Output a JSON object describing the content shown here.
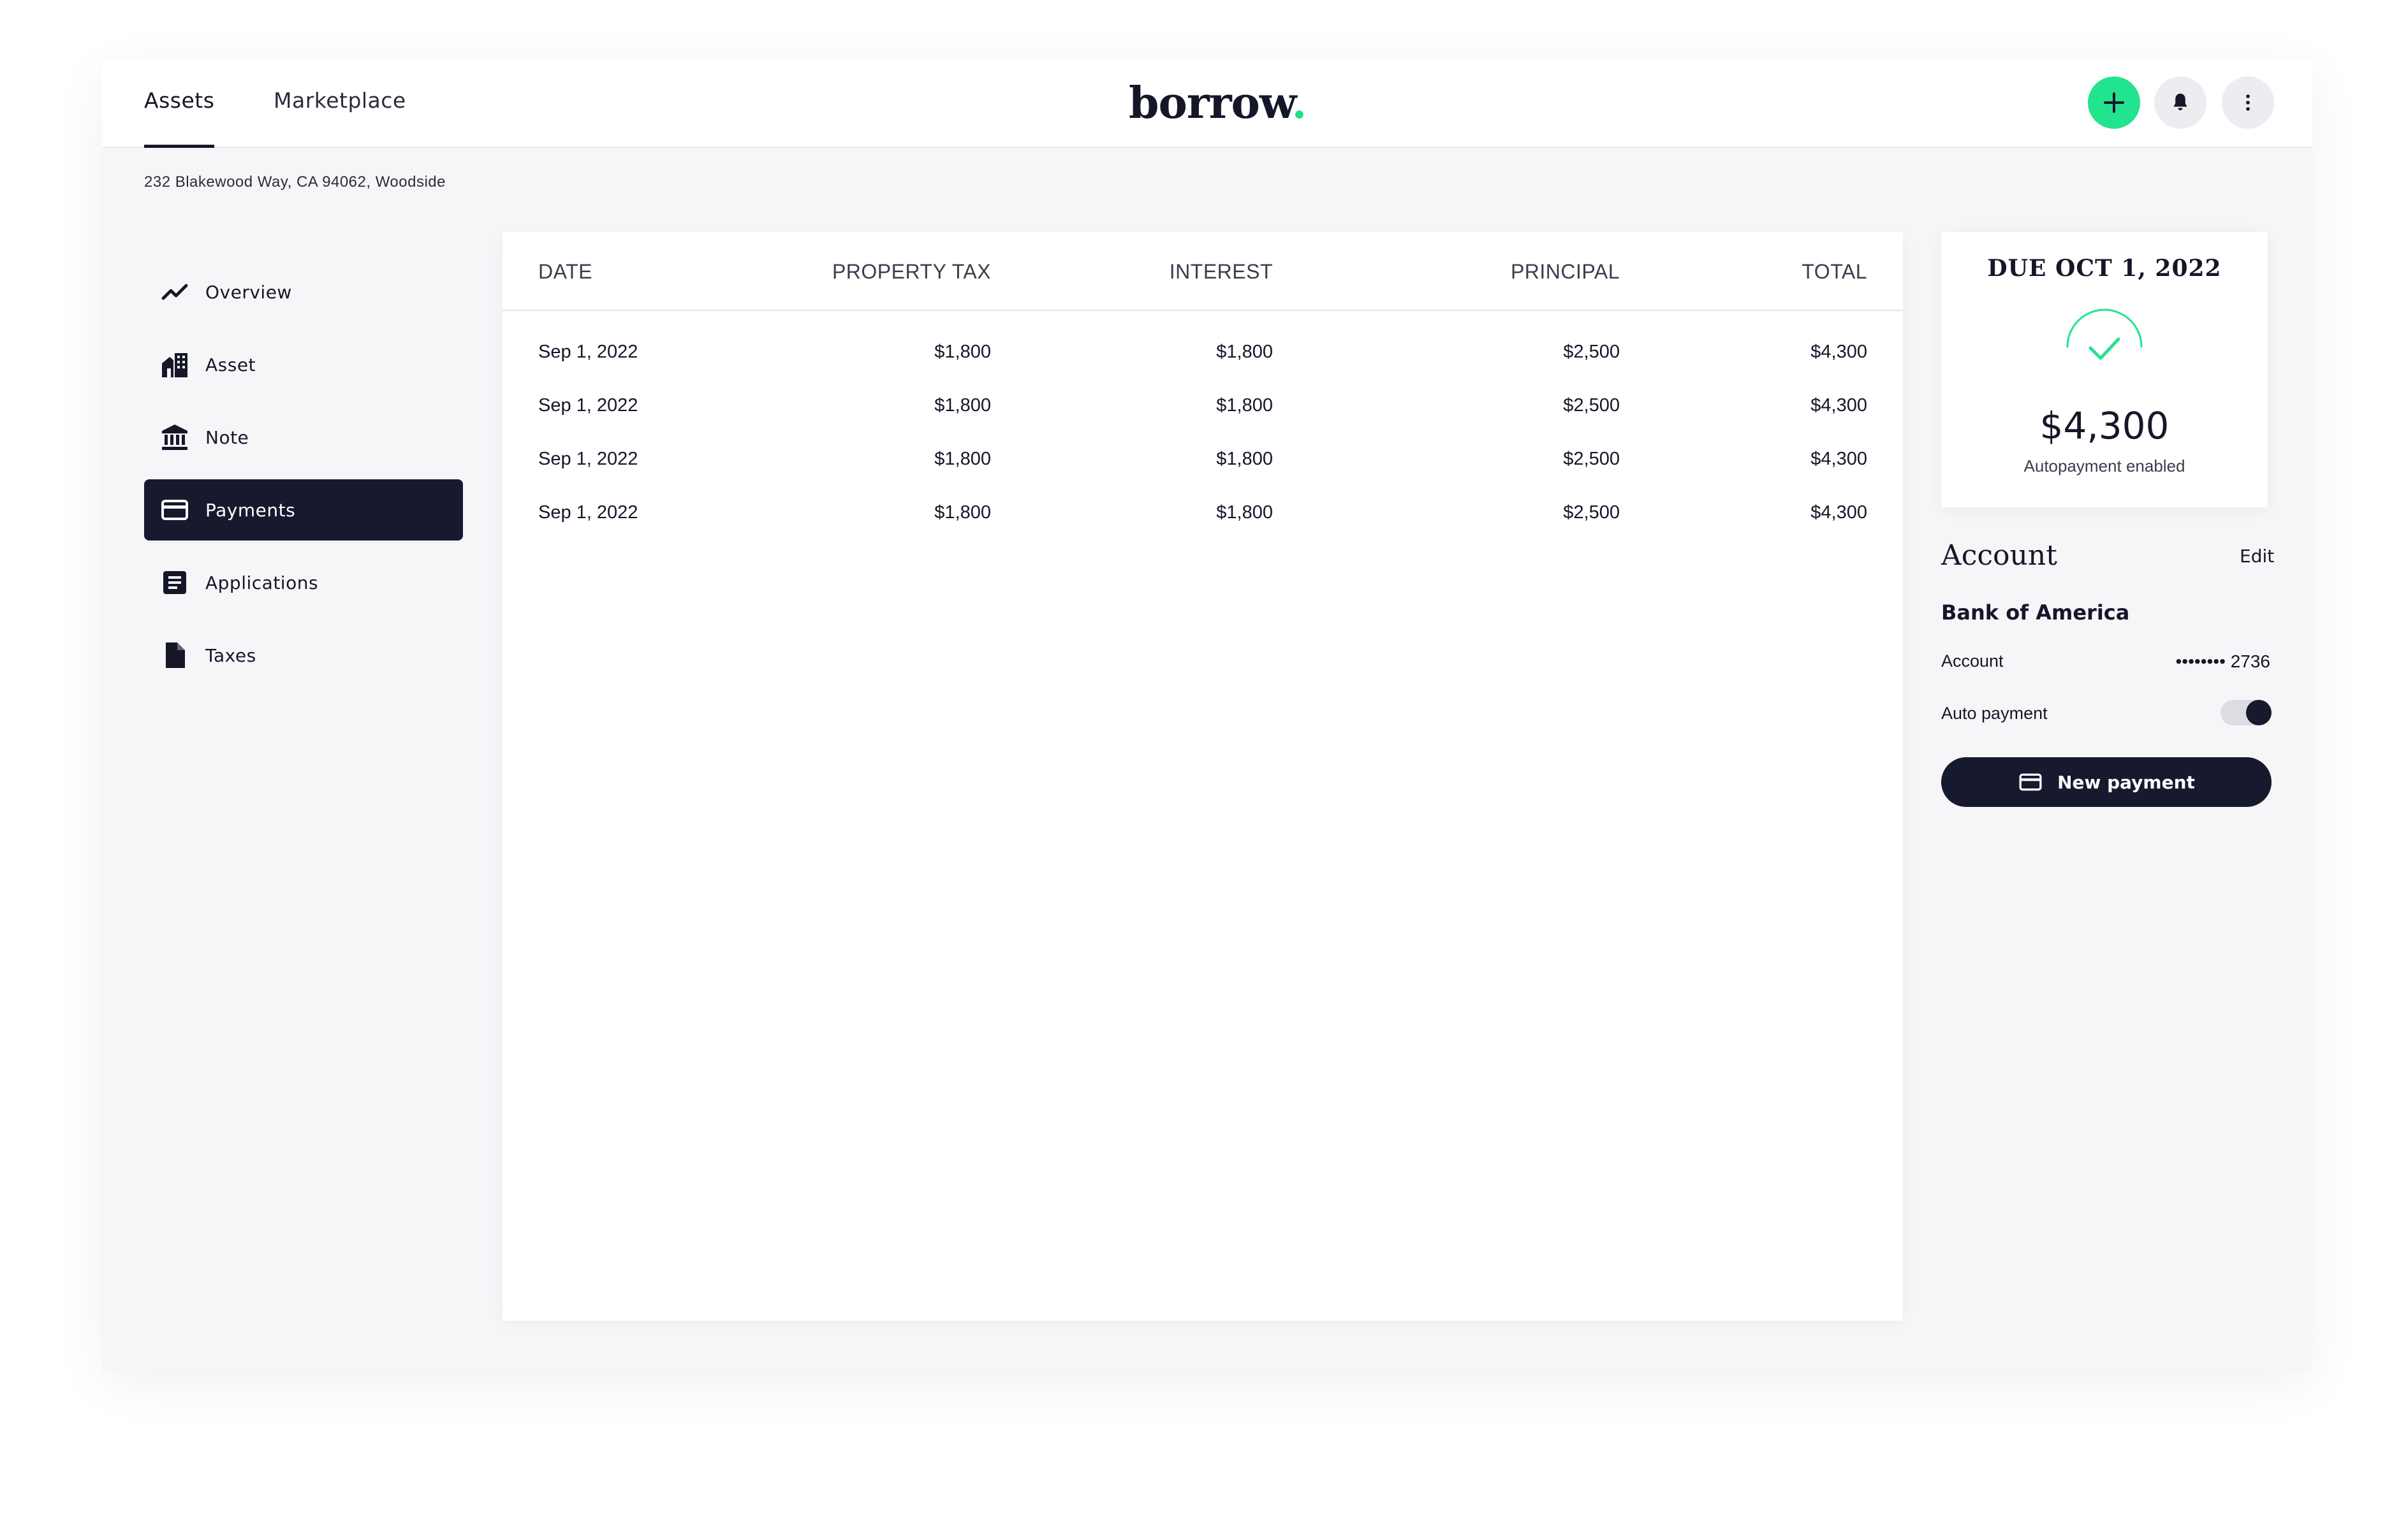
{
  "header": {
    "tabs": [
      {
        "label": "Assets",
        "active": true
      },
      {
        "label": "Marketplace",
        "active": false
      }
    ],
    "logo": {
      "text": "borrow",
      "dot": "."
    },
    "icons": {
      "add": "plus-icon",
      "notifications": "bell-icon",
      "more": "more-vertical-icon"
    },
    "accent_color": "#22e48e"
  },
  "address": "232 Blakewood Way, CA 94062, Woodside",
  "sidebar": {
    "items": [
      {
        "label": "Overview",
        "icon": "trending-line-icon",
        "active": false
      },
      {
        "label": "Asset",
        "icon": "building-icon",
        "active": false
      },
      {
        "label": "Note",
        "icon": "bank-icon",
        "active": false
      },
      {
        "label": "Payments",
        "icon": "credit-card-icon",
        "active": true
      },
      {
        "label": "Applications",
        "icon": "document-list-icon",
        "active": false
      },
      {
        "label": "Taxes",
        "icon": "file-icon",
        "active": false
      }
    ]
  },
  "table": {
    "columns": [
      "DATE",
      "PROPERTY TAX",
      "INTEREST",
      "PRINCIPAL",
      "TOTAL"
    ],
    "rows": [
      [
        "Sep 1, 2022",
        "$1,800",
        "$1,800",
        "$2,500",
        "$4,300"
      ],
      [
        "Sep 1, 2022",
        "$1,800",
        "$1,800",
        "$2,500",
        "$4,300"
      ],
      [
        "Sep 1, 2022",
        "$1,800",
        "$1,800",
        "$2,500",
        "$4,300"
      ],
      [
        "Sep 1, 2022",
        "$1,800",
        "$1,800",
        "$2,500",
        "$4,300"
      ]
    ]
  },
  "due": {
    "title": "DUE OCT 1, 2022",
    "amount": "$4,300",
    "status": "Autopayment enabled",
    "icon": "check-circle-icon"
  },
  "account": {
    "title": "Account",
    "edit_label": "Edit",
    "bank": "Bank of America",
    "account_label": "Account",
    "account_number": "•••••••• 2736",
    "autopay_label": "Auto payment",
    "autopay_on": true,
    "new_payment_label": "New payment",
    "new_payment_icon": "credit-card-icon"
  }
}
